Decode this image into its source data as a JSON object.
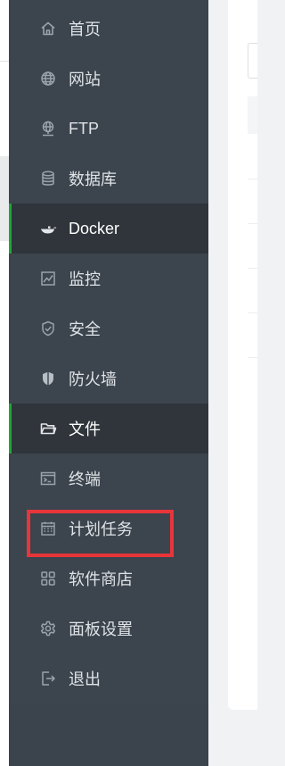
{
  "sidebar": {
    "items": [
      {
        "label": "首页",
        "icon": "home-icon",
        "active": false
      },
      {
        "label": "网站",
        "icon": "globe-icon",
        "active": false
      },
      {
        "label": "FTP",
        "icon": "ftp-icon",
        "active": false
      },
      {
        "label": "数据库",
        "icon": "database-icon",
        "active": false
      },
      {
        "label": "Docker",
        "icon": "docker-icon",
        "active": true
      },
      {
        "label": "监控",
        "icon": "monitor-chart-icon",
        "active": false
      },
      {
        "label": "安全",
        "icon": "shield-check-icon",
        "active": false
      },
      {
        "label": "防火墙",
        "icon": "firewall-shield-icon",
        "active": false
      },
      {
        "label": "文件",
        "icon": "folder-icon",
        "active": true
      },
      {
        "label": "终端",
        "icon": "terminal-icon",
        "active": false
      },
      {
        "label": "计划任务",
        "icon": "calendar-icon",
        "active": false
      },
      {
        "label": "软件商店",
        "icon": "apps-grid-icon",
        "active": false
      },
      {
        "label": "面板设置",
        "icon": "gear-icon",
        "active": false
      },
      {
        "label": "退出",
        "icon": "logout-icon",
        "active": false
      }
    ]
  },
  "highlight": {
    "target": "计划任务",
    "color": "#e8353a"
  },
  "colors": {
    "sidebar_bg": "#3c444d",
    "active_bg": "#2f353b",
    "accent": "#20a53a",
    "text": "#dfe3e7"
  }
}
